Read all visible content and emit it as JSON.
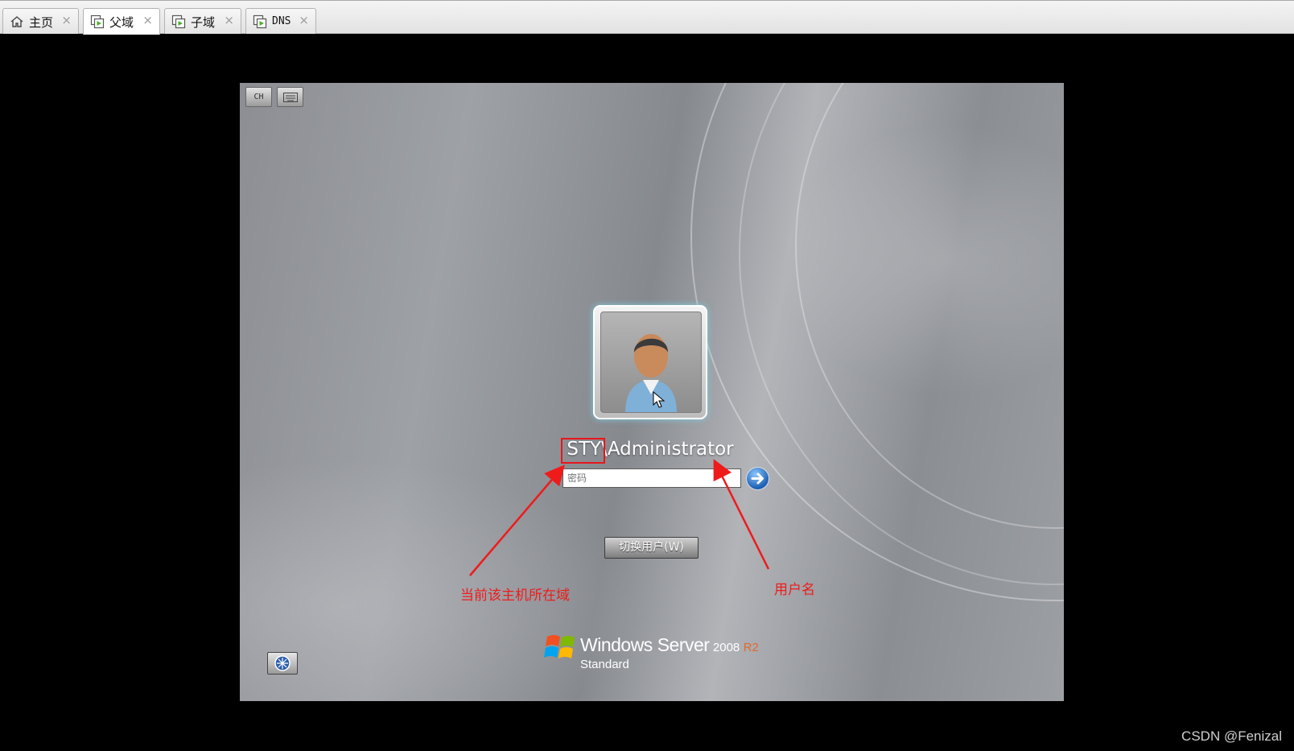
{
  "tabs": [
    {
      "label": "主页",
      "icon": "home-icon",
      "active": false
    },
    {
      "label": "父域",
      "icon": "vm-icon",
      "active": true
    },
    {
      "label": "子域",
      "icon": "vm-icon",
      "active": false
    },
    {
      "label": "DNS",
      "icon": "vm-icon",
      "active": false
    }
  ],
  "tab_close_glyph": "×",
  "login": {
    "lang_button": "CH",
    "username": "STY\\Administrator",
    "password_placeholder": "密码",
    "switch_user_label": "切换用户(W)"
  },
  "brand": {
    "product": "Windows Server",
    "version": "2008",
    "release": "R2",
    "edition": "Standard"
  },
  "annotations": {
    "domain_note": "当前该主机所在域",
    "username_note": "用户名",
    "color": "#ef1b1b"
  },
  "watermark": "CSDN @Fenizal"
}
